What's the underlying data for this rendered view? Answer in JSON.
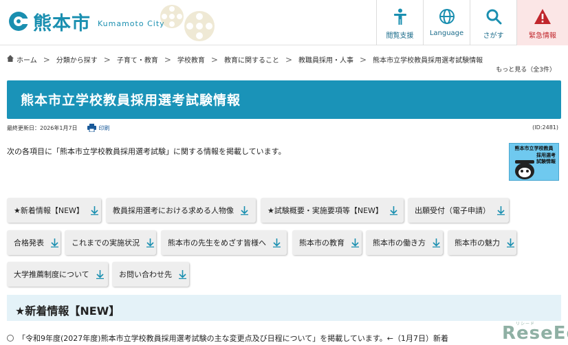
{
  "header": {
    "logo_name": "熊本市",
    "logo_en": "Kumamoto City",
    "buttons": [
      {
        "label": "閲覧支援",
        "icon": "accessibility-icon"
      },
      {
        "label": "Language",
        "icon": "globe-icon"
      },
      {
        "label": "さがす",
        "icon": "search-icon"
      },
      {
        "label": "緊急情報",
        "icon": "warning-icon"
      }
    ]
  },
  "breadcrumb": {
    "items": [
      "ホーム",
      "分類から探す",
      "子育て・教育",
      "学校教育",
      "教育に関すること",
      "教職員採用・人事",
      "熊本市立学校教員採用選考試験情報"
    ],
    "more": "もっと見る（全3件）"
  },
  "page": {
    "title": "熊本市立学校教員採用選考試験情報",
    "updated": "最終更新日：2026年1月7日",
    "print": "印刷",
    "id": "(ID:2481)",
    "intro": "次の各項目に「熊本市立学校教員採用選考試験」に関する情報を掲載しています。",
    "banner_line1": "熊本市立学校教員",
    "banner_line2": "採用選考\n試験情報"
  },
  "nav": [
    "★新着情報【NEW】",
    "教員採用選考における求める人物像",
    "★試験概要・実施要項等【NEW】",
    "出願受付（電子申請）",
    "合格発表",
    "これまでの実施状況",
    "熊本市の先生をめざす皆様へ",
    "熊本市の教育",
    "熊本市の働き方",
    "熊本市の魅力",
    "大学推薦制度について",
    "お問い合わせ先"
  ],
  "section": {
    "title": "★新着情報【NEW】",
    "item": "「令和9年度(2027年度)熊本市立学校教員採用選考試験の主な変更点及び日程について」を掲載しています。←（1月7日）新着"
  },
  "watermark": {
    "text": "ReseEd",
    "small": "リシード"
  },
  "colors": {
    "brand": "#1a93b8",
    "section_bg": "#e4f2f8",
    "emergency": "#c0262c"
  }
}
